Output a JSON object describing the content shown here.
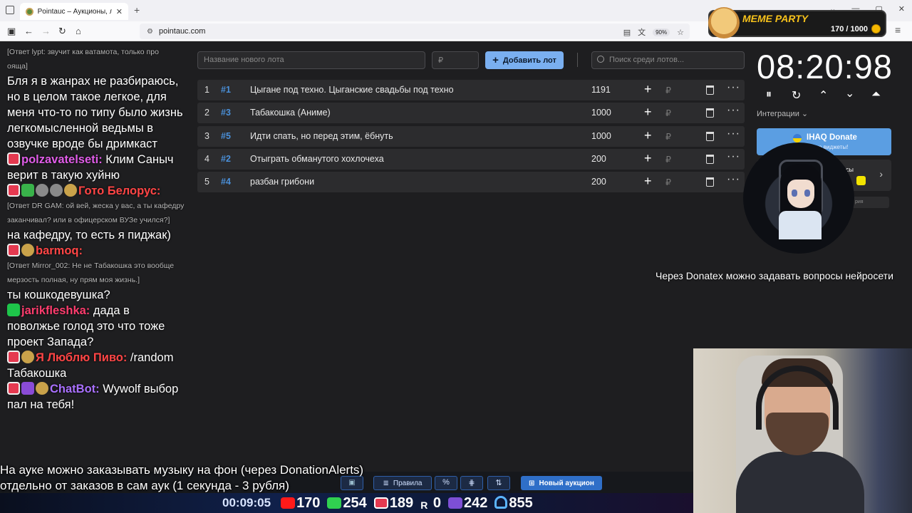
{
  "browser": {
    "tab_title": "Pointauc – Аукционы, лотерея",
    "tab_close": "✕",
    "new_tab": "+",
    "url": "pointauc.com",
    "zoom": "90%",
    "nav": {
      "back": "←",
      "forward": "→",
      "reload": "↻",
      "home": "⌂"
    },
    "window": {
      "minimize": "—",
      "maximize": "▢",
      "close": "✕",
      "chevron": "⌄"
    }
  },
  "meme_party": {
    "title": "MEME PARTY",
    "count": "170 / 1000"
  },
  "chat": {
    "lines": [
      {
        "type": "reply",
        "text": "[Ответ lypt: звучит как ватамота, только про"
      },
      {
        "type": "reply",
        "text": "ояща]"
      },
      {
        "type": "msg",
        "text": "Бля я в жанрах не разбираюсь, но в целом такое легкое, для меня что-то по типу было жизнь легкомысленной ведьмы в озвучке вроде бы дримкаст"
      },
      {
        "type": "msg",
        "user": "polzavatelseti:",
        "user_color": "#e05ce8",
        "badges": [
          "live"
        ],
        "text": " Клим Саныч верит в такую хуйню"
      },
      {
        "type": "msg",
        "user": "Гото Белорус:",
        "user_color": "#ff4545",
        "badges": [
          "live",
          "green",
          "grey",
          "grey",
          "round"
        ],
        "text": ""
      },
      {
        "type": "reply",
        "text": "[Ответ DR GAM: ой вей, жеска у вас, а ты кафедру заканчивал? или в офицерском ВУЗе учился?]"
      },
      {
        "type": "msg",
        "text": "на кафедру, то есть я пиджак)"
      },
      {
        "type": "msg",
        "user": "barmoq:",
        "user_color": "#ff4545",
        "badges": [
          "live",
          "round"
        ],
        "text": ""
      },
      {
        "type": "reply",
        "text": "[Ответ Mirror_002: Не не Табакошка это вообще мерзость полная, ну прям моя жизнь.]"
      },
      {
        "type": "msg",
        "text": "ты кошкодевушка?"
      },
      {
        "type": "msg",
        "user": "jarikfleshka:",
        "user_color": "#ff3d6e",
        "badges": [
          "k"
        ],
        "text": " дада в поволжье голод это что тоже проект Запада?"
      },
      {
        "type": "msg",
        "user": "Я Люблю Пиво:",
        "user_color": "#ff4545",
        "badges": [
          "live",
          "round"
        ],
        "text": " /random Табакошка"
      },
      {
        "type": "msg",
        "user": "ChatBot:",
        "user_color": "#a970ff",
        "badges": [
          "live",
          "purple",
          "round"
        ],
        "text": " Wywolf выбор пал на тебя!"
      }
    ]
  },
  "controls": {
    "lot_name_placeholder": "Название нового лота",
    "price_placeholder": "₽",
    "add_label": "Добавить лот",
    "add_icon": "+",
    "search_placeholder": "Поиск среди лотов..."
  },
  "lots": [
    {
      "idx": "1",
      "hash": "#1",
      "name": "Цыгане под техно. Цыганские свадьбы под техно",
      "amount": "1191"
    },
    {
      "idx": "2",
      "hash": "#3",
      "name": "Табакошка (Аниме)",
      "amount": "1000"
    },
    {
      "idx": "3",
      "hash": "#5",
      "name": "Идти спать, но перед этим, ёбнуть",
      "amount": "1000"
    },
    {
      "idx": "4",
      "hash": "#2",
      "name": "Отыграть обманутого хохлочеха",
      "amount": "200"
    },
    {
      "idx": "5",
      "hash": "#4",
      "name": "разбан грибони",
      "amount": "200"
    }
  ],
  "lot_actions": {
    "plus": "+",
    "rub": "₽",
    "more": "···"
  },
  "timer": {
    "value": "08:20:98",
    "controls": {
      "pause": "⏸",
      "reset": "↻",
      "up": "⌃",
      "down": "⌄",
      "top": "⏶"
    }
  },
  "integrations": {
    "label": "Интеграции",
    "chevron": "⌄",
    "donate_title": "IHAQ Donate",
    "donate_sub": "кальные виджеты!",
    "services_text": "исы",
    "services_arrow": "›",
    "history": "рия"
  },
  "donatex_notice": "Через Donatex можно задавать вопросы нейросети",
  "music_notice": {
    "line1": "На ауке можно заказывать музыку на фон (через DonationAlerts)",
    "line2": "отдельно от заказов в сам аук (1 секунда - 3 рубля)"
  },
  "bottom_toolbar": {
    "save": "▣",
    "rules_icon": "≣",
    "rules": "Правила",
    "percent": "%",
    "split": "⋕",
    "sort": "⇅",
    "new_icon": "⊞",
    "new_auction": "Новый аукцион"
  },
  "stream_stats": {
    "uptime": "00:09:05",
    "youtube": "170",
    "kick": "254",
    "vk_live": "189",
    "rutube": "0",
    "twitch": "242",
    "viewers": "855",
    "rutube_label": "R"
  }
}
